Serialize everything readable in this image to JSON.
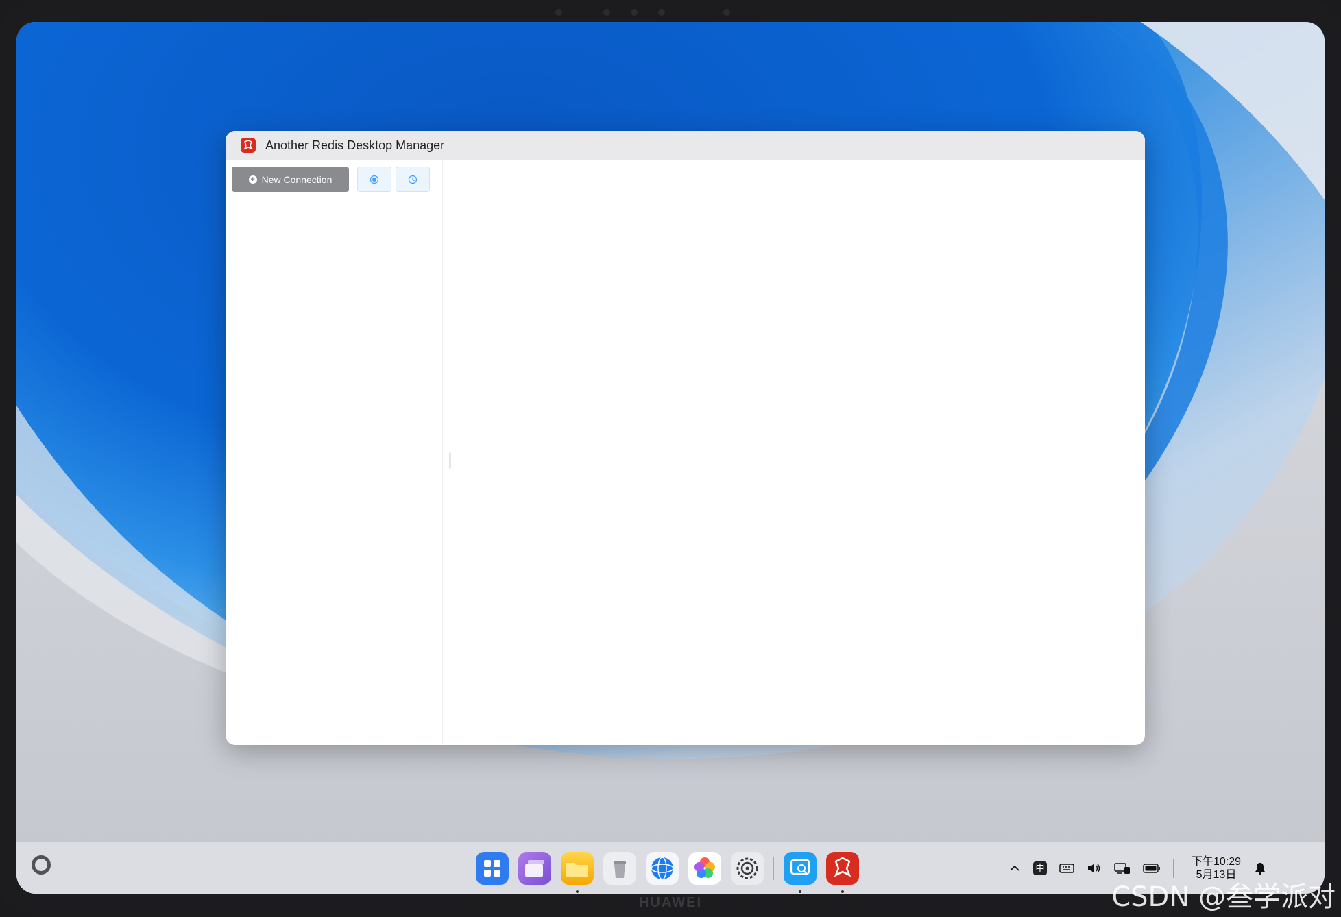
{
  "window": {
    "title": "Another Redis Desktop Manager",
    "new_connection_label": "New Connection"
  },
  "dock": {
    "items": [
      {
        "name": "app-grid-icon"
      },
      {
        "name": "multitask-icon"
      },
      {
        "name": "files-icon"
      },
      {
        "name": "trash-icon"
      },
      {
        "name": "browser-icon"
      },
      {
        "name": "gallery-icon"
      },
      {
        "name": "settings-icon"
      },
      {
        "name": "search-app-icon"
      },
      {
        "name": "redis-app-icon"
      }
    ]
  },
  "tray": {
    "ime": "中",
    "time": "下午10:29",
    "date": "5月13日"
  },
  "device": {
    "brand": "HUAWEI"
  },
  "watermark": "CSDN @叁学派对",
  "colors": {
    "accent_red": "#d82c20",
    "button_gray": "#8a8b8e",
    "icon_button_bg": "#ecf4fd",
    "icon_button_blue": "#409eff"
  }
}
